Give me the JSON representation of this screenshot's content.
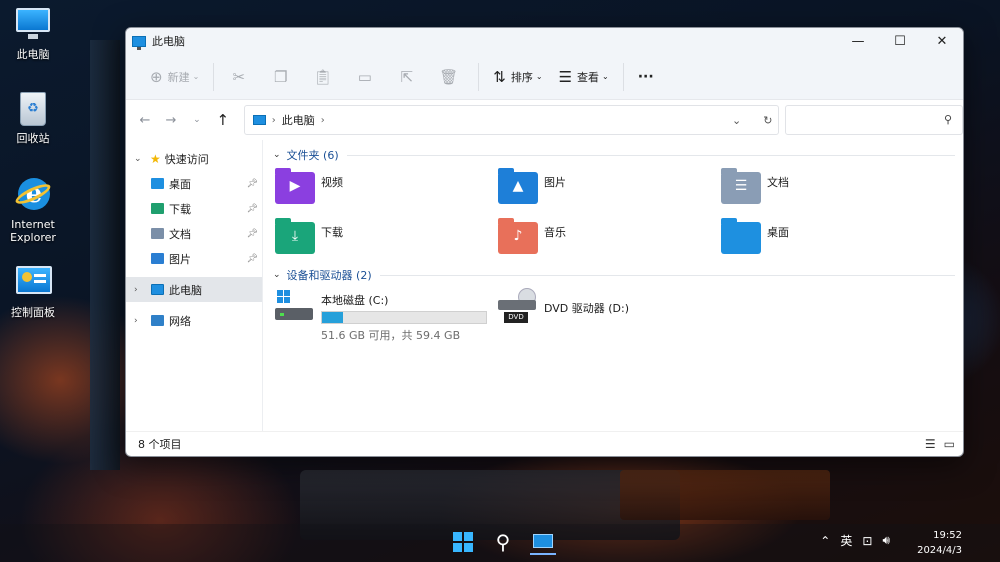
{
  "desktop": {
    "icons": [
      {
        "label": "此电脑",
        "icon": "computer-icon"
      },
      {
        "label": "回收站",
        "icon": "recycle-bin-icon"
      },
      {
        "label": "Internet\nExplorer",
        "icon": "internet-explorer-icon"
      },
      {
        "label": "控制面板",
        "icon": "control-panel-icon"
      }
    ]
  },
  "window": {
    "title": "此电脑",
    "controls": {
      "minimize": "—",
      "maximize": "☐",
      "close": "✕"
    }
  },
  "commandbar": {
    "new_label": "新建",
    "sort_label": "排序",
    "view_label": "查看",
    "more_label": "···"
  },
  "address": {
    "crumb": "此电脑",
    "search_placeholder": ""
  },
  "sidebar": {
    "quick_access": "快速访问",
    "items": [
      {
        "label": "桌面",
        "pinned": true,
        "color": "#1e8fe0"
      },
      {
        "label": "下载",
        "pinned": true,
        "color": "#1f9f6e"
      },
      {
        "label": "文档",
        "pinned": true,
        "color": "#7b8fa8"
      },
      {
        "label": "图片",
        "pinned": true,
        "color": "#2a7ed2"
      }
    ],
    "this_pc": "此电脑",
    "network": "网络"
  },
  "content": {
    "folders_header": "文件夹 (6)",
    "folders": [
      {
        "label": "视频",
        "color": "#8b3fe0",
        "icon": "video-folder-icon"
      },
      {
        "label": "图片",
        "color": "#1e7fd8",
        "icon": "pictures-folder-icon"
      },
      {
        "label": "文档",
        "color": "#8a9db5",
        "icon": "documents-folder-icon"
      },
      {
        "label": "下载",
        "color": "#1aa57a",
        "icon": "downloads-folder-icon"
      },
      {
        "label": "音乐",
        "color": "#e8705a",
        "icon": "music-folder-icon"
      },
      {
        "label": "桌面",
        "color": "#1e90e0",
        "icon": "desktop-folder-icon"
      }
    ],
    "drives_header": "设备和驱动器 (2)",
    "drives": {
      "c": {
        "name": "本地磁盘 (C:)",
        "free": "51.6 GB 可用，共 59.4 GB",
        "used_fraction": 0.13
      },
      "d": {
        "name": "DVD 驱动器 (D:)",
        "badge": "DVD"
      }
    }
  },
  "status": {
    "items": "8 个项目"
  },
  "taskbar": {
    "tray_lang": "英",
    "time": "19:52",
    "date": "2024/4/3"
  }
}
